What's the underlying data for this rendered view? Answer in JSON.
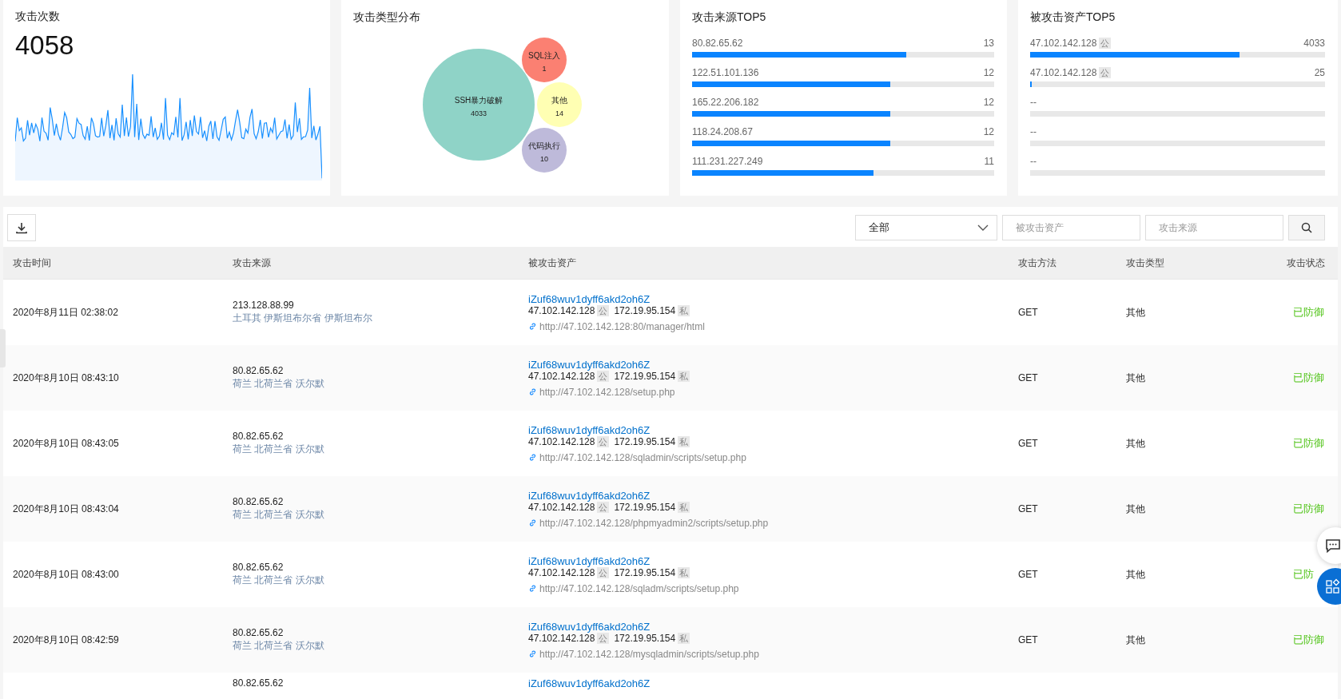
{
  "attack_count": {
    "title": "攻击次数",
    "value": "4058"
  },
  "type_distribution": {
    "title": "攻击类型分布",
    "bubbles": [
      {
        "label": "SSH暴力破解",
        "value": "4033",
        "color": "#8fd3c7"
      },
      {
        "label": "SQL注入",
        "value": "1",
        "color": "#fb8072"
      },
      {
        "label": "其他",
        "value": "14",
        "color": "#ffffb3"
      },
      {
        "label": "代码执行",
        "value": "10",
        "color": "#bebada"
      }
    ]
  },
  "top_sources": {
    "title": "攻击来源TOP5",
    "items": [
      {
        "label": "80.82.65.62",
        "count": "13",
        "level": 0.71
      },
      {
        "label": "122.51.101.136",
        "count": "12",
        "level": 0.655
      },
      {
        "label": "165.22.206.182",
        "count": "12",
        "level": 0.655
      },
      {
        "label": "118.24.208.67",
        "count": "12",
        "level": 0.655
      },
      {
        "label": "111.231.227.249",
        "count": "11",
        "level": 0.6
      }
    ]
  },
  "top_assets": {
    "title": "被攻击资产TOP5",
    "items": [
      {
        "label": "47.102.142.128",
        "tag": "公",
        "count": "4033",
        "level": 0.71
      },
      {
        "label": "47.102.142.128",
        "tag": "公",
        "count": "25",
        "level": 0.006
      },
      {
        "label": "--"
      },
      {
        "label": "--"
      },
      {
        "label": "--"
      }
    ]
  },
  "toolbar": {
    "filter": {
      "value": "全部"
    },
    "asset_search": {
      "placeholder": "被攻击资产"
    },
    "source_search": {
      "placeholder": "攻击来源"
    }
  },
  "table": {
    "columns": [
      "攻击时间",
      "攻击来源",
      "被攻击资产",
      "攻击方法",
      "攻击类型",
      "攻击状态"
    ],
    "rows": [
      {
        "time": "2020年8月11日 02:38:02",
        "source_ip": "213.128.88.99",
        "source_location": "土耳其 伊斯坦布尔省 伊斯坦布尔",
        "host": "iZuf68wuv1dyff6akd2oh6Z",
        "public_ip": "47.102.142.128",
        "public_tag": "公",
        "private_ip": "172.19.95.154",
        "private_tag": "私",
        "url": "http://47.102.142.128:80/manager/html",
        "method": "GET",
        "type": "其他",
        "status": "已防御"
      },
      {
        "time": "2020年8月10日 08:43:10",
        "source_ip": "80.82.65.62",
        "source_location": "荷兰 北荷兰省 沃尔默",
        "host": "iZuf68wuv1dyff6akd2oh6Z",
        "public_ip": "47.102.142.128",
        "public_tag": "公",
        "private_ip": "172.19.95.154",
        "private_tag": "私",
        "url": "http://47.102.142.128/setup.php",
        "method": "GET",
        "type": "其他",
        "status": "已防御"
      },
      {
        "time": "2020年8月10日 08:43:05",
        "source_ip": "80.82.65.62",
        "source_location": "荷兰 北荷兰省 沃尔默",
        "host": "iZuf68wuv1dyff6akd2oh6Z",
        "public_ip": "47.102.142.128",
        "public_tag": "公",
        "private_ip": "172.19.95.154",
        "private_tag": "私",
        "url": "http://47.102.142.128/sqladmin/scripts/setup.php",
        "method": "GET",
        "type": "其他",
        "status": "已防御"
      },
      {
        "time": "2020年8月10日 08:43:04",
        "source_ip": "80.82.65.62",
        "source_location": "荷兰 北荷兰省 沃尔默",
        "host": "iZuf68wuv1dyff6akd2oh6Z",
        "public_ip": "47.102.142.128",
        "public_tag": "公",
        "private_ip": "172.19.95.154",
        "private_tag": "私",
        "url": "http://47.102.142.128/phpmyadmin2/scripts/setup.php",
        "method": "GET",
        "type": "其他",
        "status": "已防御"
      },
      {
        "time": "2020年8月10日 08:43:00",
        "source_ip": "80.82.65.62",
        "source_location": "荷兰 北荷兰省 沃尔默",
        "host": "iZuf68wuv1dyff6akd2oh6Z",
        "public_ip": "47.102.142.128",
        "public_tag": "公",
        "private_ip": "172.19.95.154",
        "private_tag": "私",
        "url": "http://47.102.142.128/sqladm/scripts/setup.php",
        "method": "GET",
        "type": "其他",
        "status": "已防"
      },
      {
        "time": "2020年8月10日 08:42:59",
        "source_ip": "80.82.65.62",
        "source_location": "荷兰 北荷兰省 沃尔默",
        "host": "iZuf68wuv1dyff6akd2oh6Z",
        "public_ip": "47.102.142.128",
        "public_tag": "公",
        "private_ip": "172.19.95.154",
        "private_tag": "私",
        "url": "http://47.102.142.128/mysqladmin/scripts/setup.php",
        "method": "GET",
        "type": "其他",
        "status": "已防御"
      },
      {
        "source_ip": "80.82.65.62",
        "host": "iZuf68wuv1dyff6akd2oh6Z"
      }
    ]
  }
}
